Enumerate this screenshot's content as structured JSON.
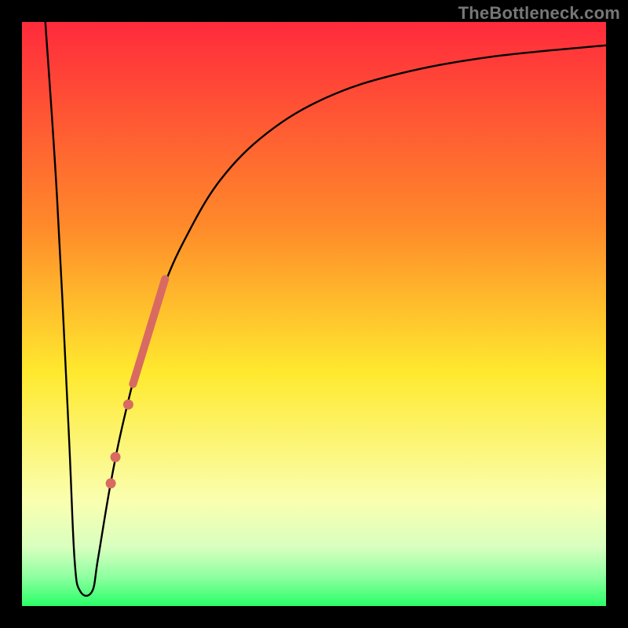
{
  "watermark": "TheBottleneck.com",
  "chart_data": {
    "type": "line",
    "title": "",
    "xlabel": "",
    "ylabel": "",
    "xlim": [
      0,
      100
    ],
    "ylim": [
      0,
      100
    ],
    "background_gradient": {
      "stops": [
        {
          "pos": 0.0,
          "color": "#ff2a3c"
        },
        {
          "pos": 0.35,
          "color": "#ff8a2a"
        },
        {
          "pos": 0.6,
          "color": "#ffe92e"
        },
        {
          "pos": 0.82,
          "color": "#faffb0"
        },
        {
          "pos": 0.9,
          "color": "#d8ffbf"
        },
        {
          "pos": 0.95,
          "color": "#8effa0"
        },
        {
          "pos": 1.0,
          "color": "#2aff68"
        }
      ]
    },
    "series": [
      {
        "name": "bottleneck-curve",
        "type": "line",
        "color": "#000000",
        "width": 2.4,
        "points": [
          {
            "x": 4,
            "y": 100
          },
          {
            "x": 6,
            "y": 70
          },
          {
            "x": 8,
            "y": 30
          },
          {
            "x": 9,
            "y": 8
          },
          {
            "x": 10,
            "y": 2.5
          },
          {
            "x": 12,
            "y": 2.5
          },
          {
            "x": 13,
            "y": 8
          },
          {
            "x": 15,
            "y": 20
          },
          {
            "x": 17,
            "y": 30
          },
          {
            "x": 20,
            "y": 42
          },
          {
            "x": 24,
            "y": 54
          },
          {
            "x": 28,
            "y": 63
          },
          {
            "x": 34,
            "y": 73
          },
          {
            "x": 42,
            "y": 81
          },
          {
            "x": 52,
            "y": 87
          },
          {
            "x": 64,
            "y": 91
          },
          {
            "x": 80,
            "y": 94
          },
          {
            "x": 100,
            "y": 96
          }
        ]
      },
      {
        "name": "highlight-segment",
        "type": "line",
        "color": "#d86a62",
        "width": 10,
        "cap": "round",
        "points": [
          {
            "x": 19.0,
            "y": 38
          },
          {
            "x": 24.5,
            "y": 56
          }
        ]
      },
      {
        "name": "highlight-dots",
        "type": "scatter",
        "color": "#d86a62",
        "radius": 6.5,
        "points": [
          {
            "x": 18.2,
            "y": 34.5
          },
          {
            "x": 16.0,
            "y": 25.5
          },
          {
            "x": 15.2,
            "y": 21.0
          }
        ]
      }
    ]
  }
}
